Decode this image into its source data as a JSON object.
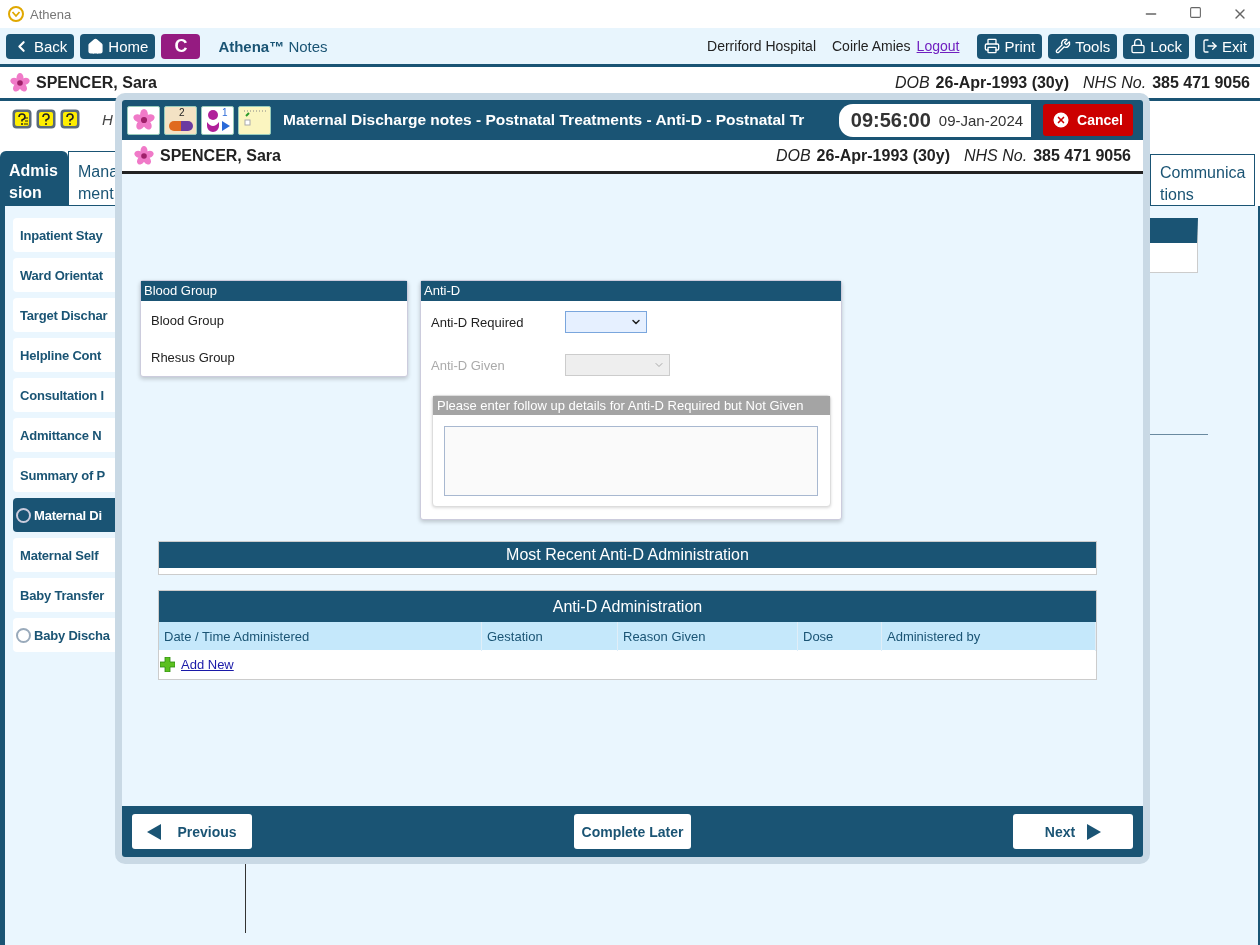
{
  "app_title": "Athena",
  "toolbar": {
    "nav_buttons": [
      {
        "kind": "back",
        "label": "Back"
      },
      {
        "kind": "home",
        "label": "Home"
      },
      {
        "kind": "letter",
        "label": "C"
      }
    ],
    "brand": "Athena™",
    "brand_suffix": "Notes",
    "location": "Derriford Hospital",
    "user": "Coirle Amies",
    "logout": "Logout",
    "actions": [
      {
        "kind": "print",
        "label": "Print"
      },
      {
        "kind": "tools",
        "label": "Tools"
      },
      {
        "kind": "lock",
        "label": "Lock"
      },
      {
        "kind": "exit",
        "label": "Exit"
      }
    ]
  },
  "patient": {
    "name": "SPENCER, Sara",
    "dob_label": "DOB",
    "dob": "26-Apr-1993 (30y)",
    "nhs_label": "NHS No.",
    "nhs": "385 471 9056"
  },
  "help_text": "H",
  "tabs": [
    {
      "lines": [
        "Admis",
        "sion"
      ],
      "selected": true
    },
    {
      "lines": [
        "Mana",
        "ment"
      ],
      "selected": false
    }
  ],
  "far_tabs": [
    {
      "lines": [
        "Communica",
        "tions"
      ],
      "selected": false
    }
  ],
  "sidebar": {
    "items": [
      {
        "label": "Inpatient Stay",
        "kind": "plain",
        "selected": false
      },
      {
        "label": "Ward Orientat",
        "kind": "plain",
        "selected": false
      },
      {
        "label": "Target Dischar",
        "kind": "plain",
        "selected": false
      },
      {
        "label": "Helpline Cont",
        "kind": "plain",
        "selected": false
      },
      {
        "label": "Consultation I",
        "kind": "plain",
        "selected": false
      },
      {
        "label": "Admittance N",
        "kind": "plain",
        "selected": false
      },
      {
        "label": "Summary of P",
        "kind": "plain",
        "selected": false
      },
      {
        "label": "Maternal Di",
        "kind": "radio",
        "selected": true
      },
      {
        "label": "Maternal Self",
        "kind": "plain",
        "selected": false
      },
      {
        "label": "Baby Transfer",
        "kind": "plain",
        "selected": false
      },
      {
        "label": "Baby Discha",
        "kind": "radio",
        "selected": false
      }
    ]
  },
  "dialog": {
    "icons": [
      {
        "kind": "flower"
      },
      {
        "kind": "pill",
        "count": "2"
      },
      {
        "kind": "person",
        "count": "1"
      },
      {
        "kind": "notes"
      }
    ],
    "title": "Maternal Discharge notes - Postnatal Treatments - Anti-D - Postnatal Tr",
    "time": "09:56:00",
    "date": "09-Jan-2024",
    "cancel": "Cancel",
    "patient": {
      "name": "SPENCER, Sara",
      "dob_label": "DOB",
      "dob": "26-Apr-1993 (30y)",
      "nhs_label": "NHS No.",
      "nhs": "385 471 9056"
    },
    "blood_group": {
      "title": "Blood Group",
      "rows": [
        "Blood Group",
        "Rhesus Group"
      ]
    },
    "anti_d": {
      "title": "Anti-D",
      "fields": [
        {
          "label": "Anti-D Required",
          "disabled": false
        },
        {
          "label": "Anti-D Given",
          "disabled": true
        }
      ],
      "followup": {
        "title": "Please enter follow up details for Anti-D Required but Not Given",
        "disabled": true
      }
    },
    "most_recent": {
      "title": "Most Recent Anti-D Administration"
    },
    "administration": {
      "title": "Anti-D Administration",
      "columns": [
        "Date / Time Administered",
        "Gestation",
        "Reason Given",
        "Dose",
        "Administered by"
      ],
      "add_new": "Add New"
    },
    "footer": {
      "previous": "Previous",
      "complete_later": "Complete Later",
      "next": "Next"
    }
  }
}
